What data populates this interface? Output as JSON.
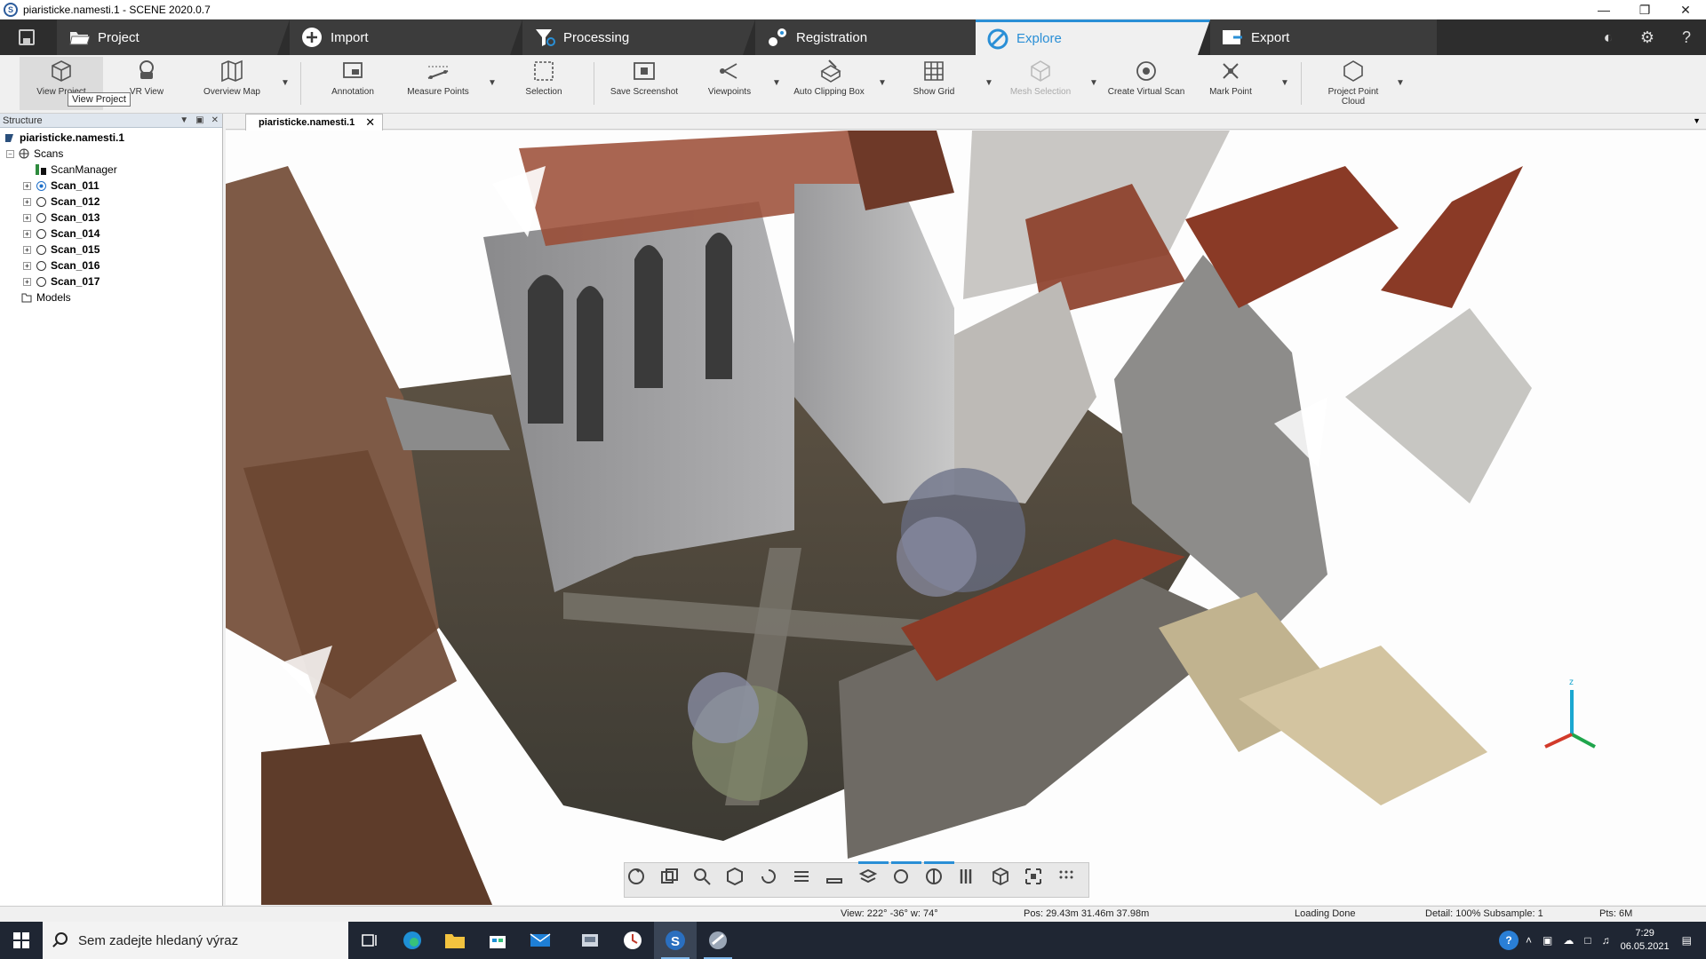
{
  "window": {
    "title": "piaristicke.namesti.1 - SCENE 2020.0.7"
  },
  "main_tabs": [
    {
      "label": "Project"
    },
    {
      "label": "Import"
    },
    {
      "label": "Processing"
    },
    {
      "label": "Registration"
    },
    {
      "label": "Explore"
    },
    {
      "label": "Export"
    }
  ],
  "active_tab": "Explore",
  "accent_color": "#2a8fd6",
  "ribbon": {
    "buttons": [
      {
        "label": "View Project",
        "icon": "cube-icon"
      },
      {
        "label": "VR View",
        "icon": "vr-headset-icon"
      },
      {
        "label": "Overview Map",
        "icon": "map-icon"
      },
      {
        "label": "Annotation",
        "icon": "annotation-icon"
      },
      {
        "label": "Measure Points",
        "icon": "measure-icon"
      },
      {
        "label": "Selection",
        "icon": "selection-icon"
      },
      {
        "label": "Save Screenshot",
        "icon": "screenshot-icon"
      },
      {
        "label": "Viewpoints",
        "icon": "viewpoints-icon"
      },
      {
        "label": "Auto Clipping Box",
        "icon": "clipping-box-icon"
      },
      {
        "label": "Show Grid",
        "icon": "grid-icon"
      },
      {
        "label": "Mesh Selection",
        "icon": "mesh-icon"
      },
      {
        "label": "Create Virtual Scan",
        "icon": "virtual-scan-icon"
      },
      {
        "label": "Mark Point",
        "icon": "mark-point-icon"
      },
      {
        "label": "Project Point Cloud",
        "icon": "point-cloud-icon"
      }
    ],
    "tooltip": "View Project"
  },
  "structure": {
    "title": "Structure",
    "root": "piaristicke.namesti.1",
    "scans_label": "Scans",
    "scan_manager": "ScanManager",
    "scans": [
      "Scan_011",
      "Scan_012",
      "Scan_013",
      "Scan_014",
      "Scan_015",
      "Scan_016",
      "Scan_017"
    ],
    "models_label": "Models"
  },
  "document_tab": {
    "label": "piaristicke.namesti.1"
  },
  "status": {
    "view": "View: 222° -36° w: 74°",
    "pos": "Pos: 29.43m 31.46m 37.98m",
    "loading": "Loading Done",
    "detail": "Detail: 100%  Subsample:  1",
    "pts": "Pts:  6M"
  },
  "taskbar": {
    "search_placeholder": "Sem zadejte hledaný výraz",
    "time": "7:29",
    "date": "06.05.2021"
  }
}
